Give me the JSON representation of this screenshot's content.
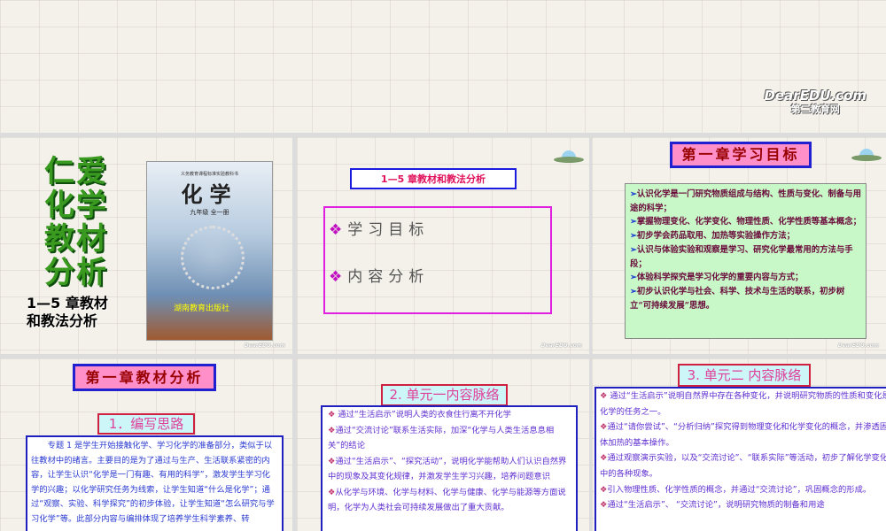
{
  "banner": {
    "logo": "DearEDU.com",
    "logo_sub": "第二教育网"
  },
  "slide1": {
    "big_title": [
      "仁",
      "爱",
      "化",
      "学",
      "教",
      "材",
      "分",
      "析"
    ],
    "subtitle_line1": "1—5 章教材",
    "subtitle_line2": "和教法分析",
    "book": {
      "series": "义务教育课程标准实验教科书",
      "title": "化学",
      "grade": "九年级 全一册",
      "publisher": "湖南教育出版社"
    }
  },
  "slide2": {
    "header": "1—5 章教材和教法分析",
    "items": [
      "学习目标",
      "内容分析"
    ]
  },
  "slide3": {
    "title": "第一章学习目标",
    "goals": [
      "认识化学是一门研究物质组成与结构、性质与变化、制备与用途的科学；",
      "掌握物理变化、化学变化、物理性质、化学性质等基本概念；",
      "初步学会药品取用、加热等实验操作方法；",
      "认识与体验实验和观察是学习、研究化学最常用的方法与手段；",
      "体验科学探究是学习化学的重要内容与方式；",
      "初步认识化学与社会、科学、技术与生活的联系，初步树立“可持续发展”思想。"
    ]
  },
  "slide4": {
    "title": "第一章教材分析",
    "section": "1．编写思路",
    "text": "专题 1 是学生开始接触化学、学习化学的准备部分，类似于以往教材中的绪言。主要目的是为了通过与生产、生活联系紧密的内容，让学生认识“化学是一门有趣、有用的科学”，激发学生学习化学的兴趣；以化学研究任务为线索，让学生知道“什么是化学”；通过“观察、实验、科学探究”的初步体验，让学生知道“怎么研究与学习化学”等。此部分内容与编排体现了培养学生科学素养、转"
  },
  "slide5": {
    "title": "2. 单元一内容脉络",
    "items": [
      " 通过“生活启示”说明人类的衣食住行离不开化学",
      "通过“交流讨论”联系生活实际，加深“化学与人类生活息息相关”的结论",
      "通过“生活启示”、“探究活动”，说明化学能帮助人们认识自然界中的现象及其变化规律，并激发学生学习兴趣，培养问题意识",
      "从化学与环境、化学与材料、化学与健康、化学与能源等方面说明，化学为人类社会可持续发展做出了重大贡献。"
    ]
  },
  "slide6": {
    "title": "3. 单元二 内容脉络",
    "items": [
      " 通过“生活启示”说明自然界中存在各种变化，并说明研究物质的性质和变化是化学的任务之一。",
      "通过“请你尝试”、“分析归纳”探究得到物理变化和化学变化的概念，并渗透固体加热的基本操作。",
      "通过观察演示实验，以及“交流讨论”、“联系实际”等活动，初步了解化学变化中的各种现象。",
      "引入物理性质、化学性质的概念，并通过“交流讨论”，巩固概念的形成。",
      "通过“生活启示”、 “交流讨论”，说明研究物质的制备和用途"
    ]
  },
  "bullets": {
    "diamond": "❖",
    "arrow": "➢"
  },
  "mini_logo": "DearEDU.com"
}
